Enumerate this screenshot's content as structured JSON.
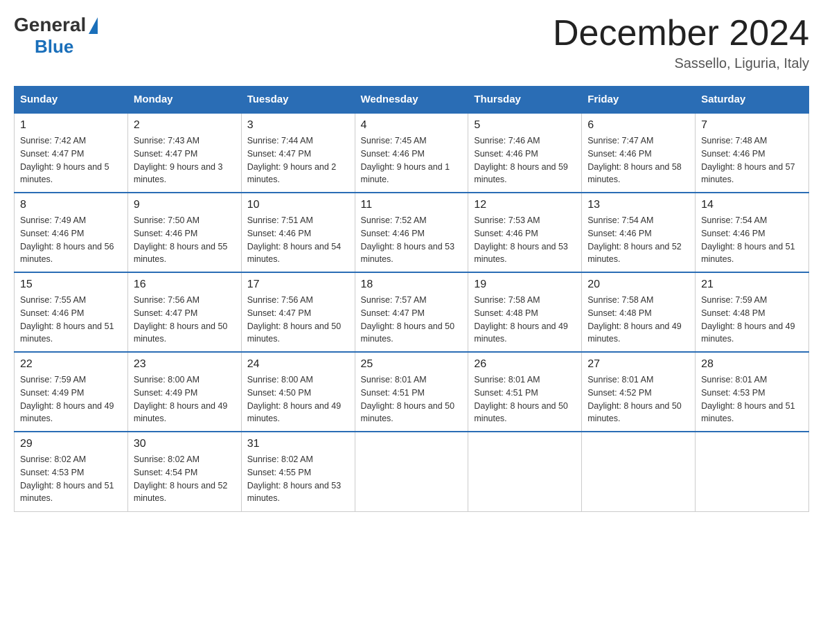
{
  "logo": {
    "general": "General",
    "blue": "Blue",
    "triangle_label": "logo-triangle"
  },
  "header": {
    "month_title": "December 2024",
    "location": "Sassello, Liguria, Italy"
  },
  "days_of_week": [
    "Sunday",
    "Monday",
    "Tuesday",
    "Wednesday",
    "Thursday",
    "Friday",
    "Saturday"
  ],
  "weeks": [
    [
      {
        "day": "1",
        "sunrise": "7:42 AM",
        "sunset": "4:47 PM",
        "daylight": "9 hours and 5 minutes."
      },
      {
        "day": "2",
        "sunrise": "7:43 AM",
        "sunset": "4:47 PM",
        "daylight": "9 hours and 3 minutes."
      },
      {
        "day": "3",
        "sunrise": "7:44 AM",
        "sunset": "4:47 PM",
        "daylight": "9 hours and 2 minutes."
      },
      {
        "day": "4",
        "sunrise": "7:45 AM",
        "sunset": "4:46 PM",
        "daylight": "9 hours and 1 minute."
      },
      {
        "day": "5",
        "sunrise": "7:46 AM",
        "sunset": "4:46 PM",
        "daylight": "8 hours and 59 minutes."
      },
      {
        "day": "6",
        "sunrise": "7:47 AM",
        "sunset": "4:46 PM",
        "daylight": "8 hours and 58 minutes."
      },
      {
        "day": "7",
        "sunrise": "7:48 AM",
        "sunset": "4:46 PM",
        "daylight": "8 hours and 57 minutes."
      }
    ],
    [
      {
        "day": "8",
        "sunrise": "7:49 AM",
        "sunset": "4:46 PM",
        "daylight": "8 hours and 56 minutes."
      },
      {
        "day": "9",
        "sunrise": "7:50 AM",
        "sunset": "4:46 PM",
        "daylight": "8 hours and 55 minutes."
      },
      {
        "day": "10",
        "sunrise": "7:51 AM",
        "sunset": "4:46 PM",
        "daylight": "8 hours and 54 minutes."
      },
      {
        "day": "11",
        "sunrise": "7:52 AM",
        "sunset": "4:46 PM",
        "daylight": "8 hours and 53 minutes."
      },
      {
        "day": "12",
        "sunrise": "7:53 AM",
        "sunset": "4:46 PM",
        "daylight": "8 hours and 53 minutes."
      },
      {
        "day": "13",
        "sunrise": "7:54 AM",
        "sunset": "4:46 PM",
        "daylight": "8 hours and 52 minutes."
      },
      {
        "day": "14",
        "sunrise": "7:54 AM",
        "sunset": "4:46 PM",
        "daylight": "8 hours and 51 minutes."
      }
    ],
    [
      {
        "day": "15",
        "sunrise": "7:55 AM",
        "sunset": "4:46 PM",
        "daylight": "8 hours and 51 minutes."
      },
      {
        "day": "16",
        "sunrise": "7:56 AM",
        "sunset": "4:47 PM",
        "daylight": "8 hours and 50 minutes."
      },
      {
        "day": "17",
        "sunrise": "7:56 AM",
        "sunset": "4:47 PM",
        "daylight": "8 hours and 50 minutes."
      },
      {
        "day": "18",
        "sunrise": "7:57 AM",
        "sunset": "4:47 PM",
        "daylight": "8 hours and 50 minutes."
      },
      {
        "day": "19",
        "sunrise": "7:58 AM",
        "sunset": "4:48 PM",
        "daylight": "8 hours and 49 minutes."
      },
      {
        "day": "20",
        "sunrise": "7:58 AM",
        "sunset": "4:48 PM",
        "daylight": "8 hours and 49 minutes."
      },
      {
        "day": "21",
        "sunrise": "7:59 AM",
        "sunset": "4:48 PM",
        "daylight": "8 hours and 49 minutes."
      }
    ],
    [
      {
        "day": "22",
        "sunrise": "7:59 AM",
        "sunset": "4:49 PM",
        "daylight": "8 hours and 49 minutes."
      },
      {
        "day": "23",
        "sunrise": "8:00 AM",
        "sunset": "4:49 PM",
        "daylight": "8 hours and 49 minutes."
      },
      {
        "day": "24",
        "sunrise": "8:00 AM",
        "sunset": "4:50 PM",
        "daylight": "8 hours and 49 minutes."
      },
      {
        "day": "25",
        "sunrise": "8:01 AM",
        "sunset": "4:51 PM",
        "daylight": "8 hours and 50 minutes."
      },
      {
        "day": "26",
        "sunrise": "8:01 AM",
        "sunset": "4:51 PM",
        "daylight": "8 hours and 50 minutes."
      },
      {
        "day": "27",
        "sunrise": "8:01 AM",
        "sunset": "4:52 PM",
        "daylight": "8 hours and 50 minutes."
      },
      {
        "day": "28",
        "sunrise": "8:01 AM",
        "sunset": "4:53 PM",
        "daylight": "8 hours and 51 minutes."
      }
    ],
    [
      {
        "day": "29",
        "sunrise": "8:02 AM",
        "sunset": "4:53 PM",
        "daylight": "8 hours and 51 minutes."
      },
      {
        "day": "30",
        "sunrise": "8:02 AM",
        "sunset": "4:54 PM",
        "daylight": "8 hours and 52 minutes."
      },
      {
        "day": "31",
        "sunrise": "8:02 AM",
        "sunset": "4:55 PM",
        "daylight": "8 hours and 53 minutes."
      },
      null,
      null,
      null,
      null
    ]
  ]
}
